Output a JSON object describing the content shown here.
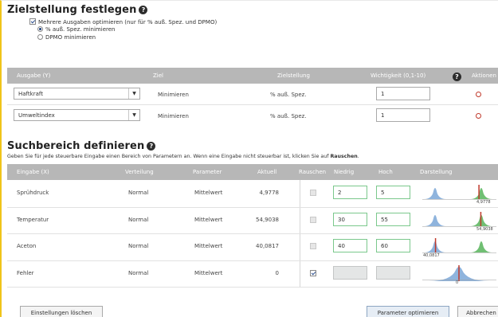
{
  "goal_section": {
    "title": "Zielstellung festlegen",
    "multi_optimize_label": "Mehrere Ausgaben optimieren (nur für % auß. Spez. und DPMO)",
    "radio_options": [
      "% auß. Spez. minimieren",
      "DPMO minimieren"
    ],
    "selected_radio": 0,
    "columns": [
      "Ausgabe (Y)",
      "Ziel",
      "Zielstellung",
      "Wichtigkeit (0,1-10)",
      "Aktionen"
    ],
    "rows": [
      {
        "output": "Haftkraft",
        "goal": "Minimieren",
        "target": "% auß. Spez.",
        "importance": "1"
      },
      {
        "output": "Umweltindex",
        "goal": "Minimieren",
        "target": "% auß. Spez.",
        "importance": "1"
      }
    ]
  },
  "search_section": {
    "title": "Suchbereich definieren",
    "instruction_prefix": "Geben Sie für jede steuerbare Eingabe einen Bereich von Parametern an. Wenn eine Eingabe nicht steuerbar ist, klicken Sie auf ",
    "instruction_bold": "Rauschen",
    "instruction_suffix": ".",
    "columns": [
      "Eingabe (X)",
      "Verteilung",
      "Parameter",
      "Aktuell",
      "Rauschen",
      "Niedrig",
      "Hoch",
      "Darstellung"
    ],
    "rows": [
      {
        "input": "Sprühdruck",
        "distribution": "Normal",
        "parameter": "Mittelwert",
        "current": "4,9778",
        "noise": false,
        "low": "2",
        "high": "5",
        "plot_label": "4,9778",
        "marker_fraction": 0.95
      },
      {
        "input": "Temperatur",
        "distribution": "Normal",
        "parameter": "Mittelwert",
        "current": "54,9038",
        "noise": false,
        "low": "30",
        "high": "55",
        "plot_label": "54,9038",
        "marker_fraction": 0.99
      },
      {
        "input": "Aceton",
        "distribution": "Normal",
        "parameter": "Mittelwert",
        "current": "40,0817",
        "noise": false,
        "low": "40",
        "high": "60",
        "plot_label": "40,0817",
        "marker_fraction": 0.01
      },
      {
        "input": "Fehler",
        "distribution": "Normal",
        "parameter": "Mittelwert",
        "current": "0",
        "noise": true,
        "low": "",
        "high": "",
        "plot_label": "0",
        "marker_fraction": 0.5
      }
    ]
  },
  "footer": {
    "clear_button": "Einstellungen löschen",
    "optimize_button": "Parameter optimieren",
    "cancel_button": "Abbrechen"
  },
  "colors": {
    "accent_border": "#f0c419",
    "header_bg": "#b7b7b7",
    "delete_icon": "#c0392b",
    "marker_red": "#c0392b",
    "dist_blue": "#6a9bd1",
    "dist_green": "#4caf50"
  },
  "icons": [
    "help-icon",
    "dropdown-arrow-icon",
    "delete-icon",
    "checkbox-icon",
    "radio-icon",
    "distribution-plot-icon"
  ]
}
